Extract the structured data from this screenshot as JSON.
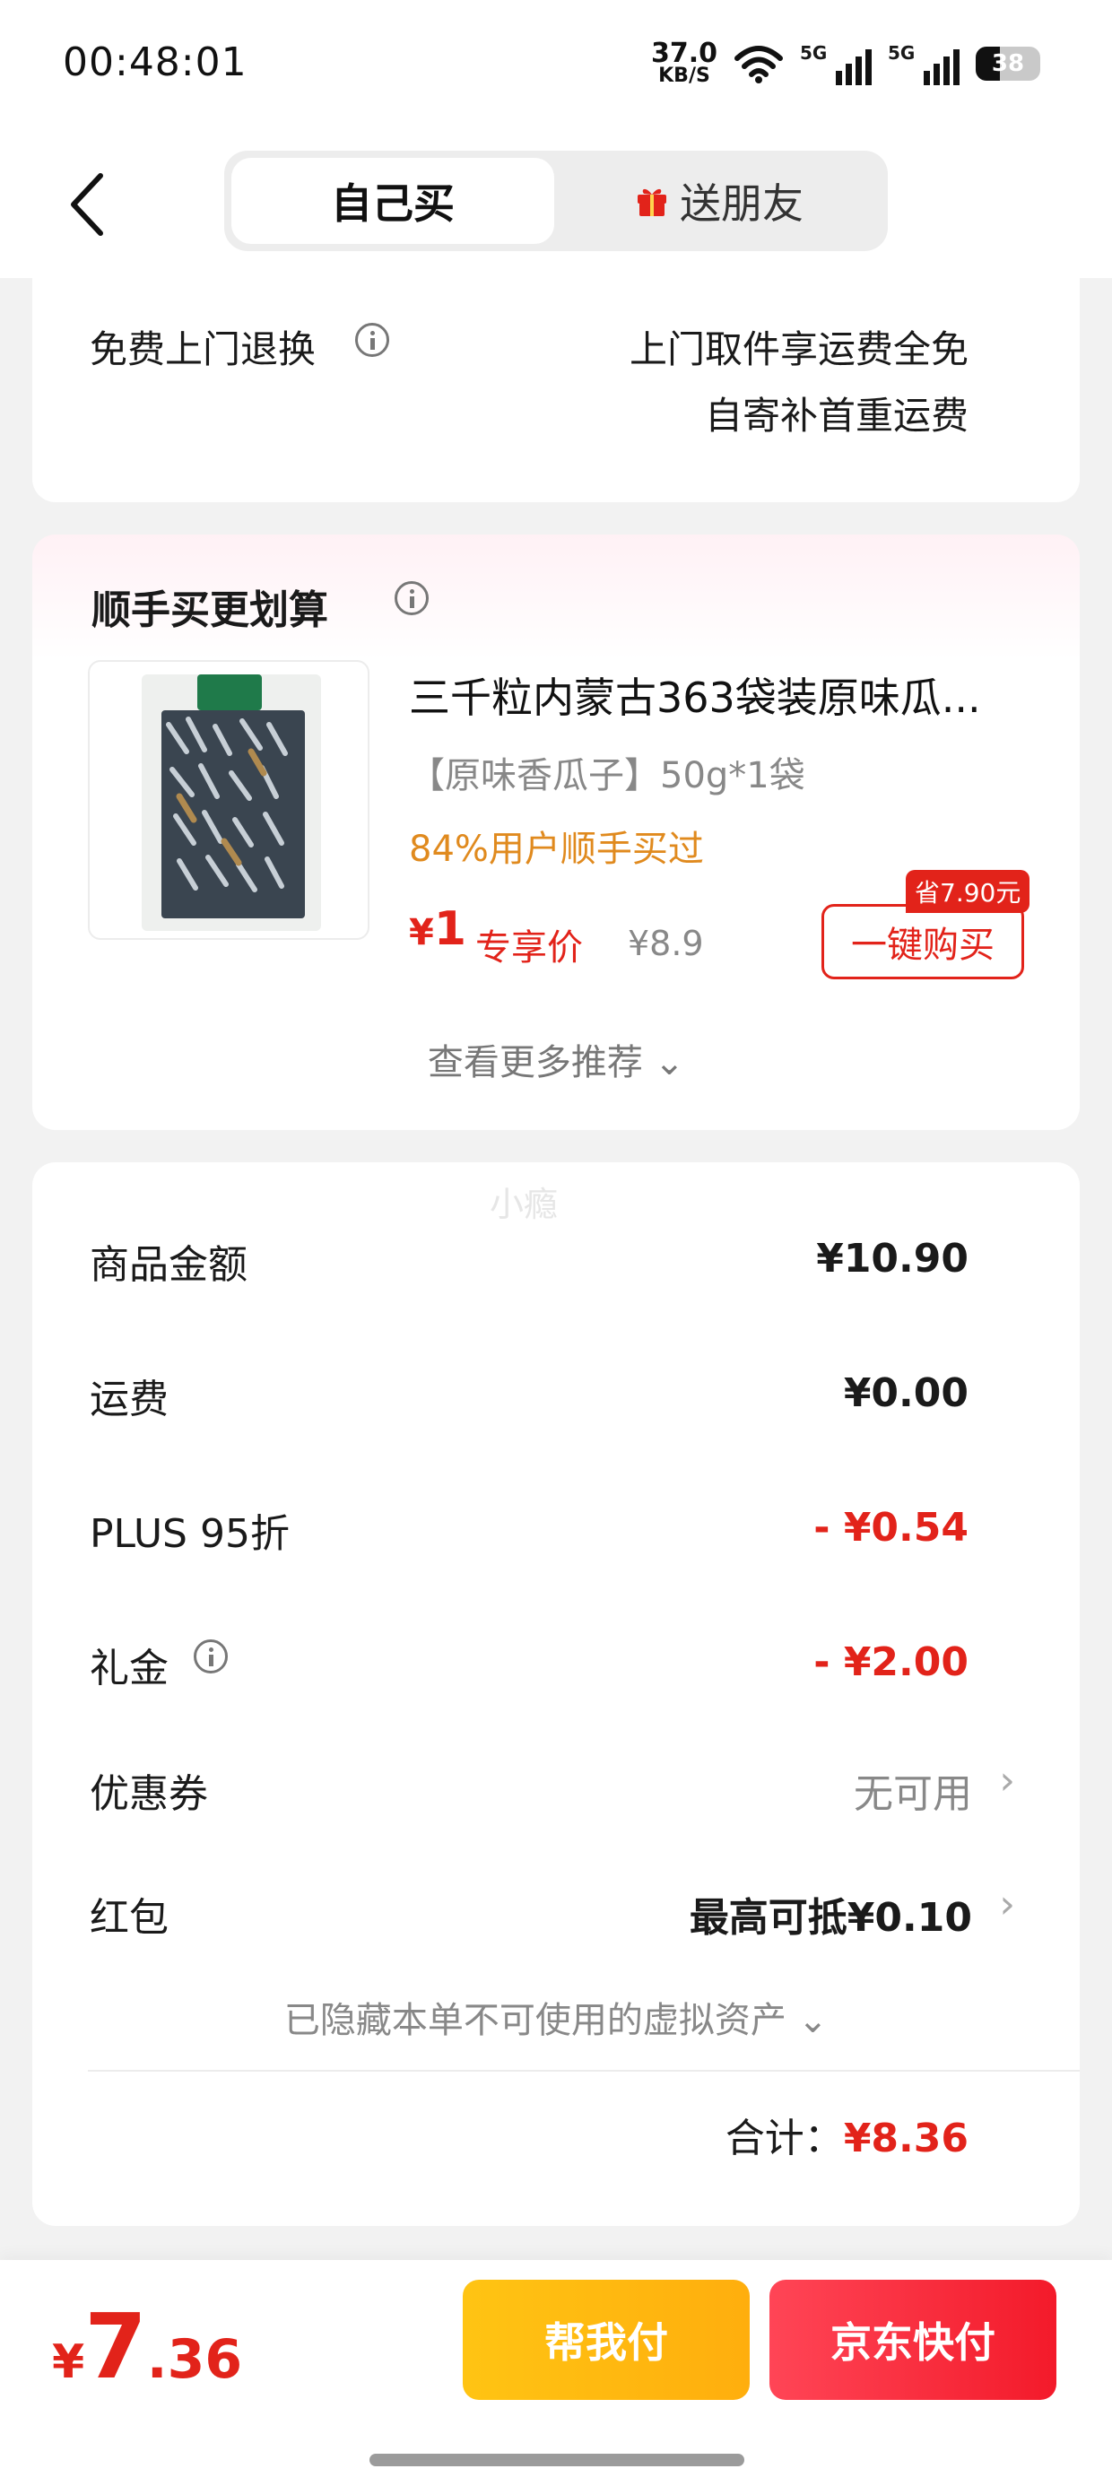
{
  "status_bar": {
    "time": "00:48:01",
    "net_speed": "37.0",
    "net_unit": "KB/S",
    "signal1_label": "5G",
    "signal2_label": "5G",
    "battery": "38"
  },
  "header": {
    "tab_self": "自己买",
    "tab_friend": "送朋友",
    "active_tab": "自己买"
  },
  "return_section": {
    "label": "免费上门退换",
    "line1": "上门取件享运费全免",
    "line2": "自寄补首重运费"
  },
  "addon_section": {
    "title": "顺手买更划算",
    "product": {
      "name": "三千粒内蒙古363袋装原味瓜...",
      "spec": "【原味香瓜子】50g*1袋",
      "social_proof": "84%用户顺手买过",
      "price_symbol": "¥",
      "price": "1",
      "price_tag": "专享价",
      "original_price": "¥8.9",
      "save_badge": "省7.90元",
      "buy_label": "一键购买"
    },
    "more_label": "查看更多推荐 ⌄"
  },
  "summary": {
    "watermark": "小瘾",
    "rows": [
      {
        "label": "商品金额",
        "value": "¥10.90"
      },
      {
        "label": "运费",
        "value": "¥0.00"
      },
      {
        "label": "PLUS 95折",
        "value": "- ¥0.54"
      },
      {
        "label": "礼金",
        "value": "- ¥2.00"
      },
      {
        "label": "优惠券",
        "value": "无可用"
      },
      {
        "label": "红包",
        "value": "最高可抵¥0.10"
      }
    ],
    "hidden_assets": "已隐藏本单不可使用的虚拟资产 ⌄",
    "total_label": "合计：",
    "total_value": "¥8.36"
  },
  "bottom_bar": {
    "pay_symbol": "¥",
    "pay_int": "7",
    "pay_dec": ".36",
    "help_pay_label": "帮我付",
    "jd_pay_label": "京东快付"
  },
  "colors": {
    "accent_red": "#e2231a",
    "orange": "#e08a1e",
    "help_btn": "#ffb80f",
    "pay_btn": "#f52a38"
  }
}
